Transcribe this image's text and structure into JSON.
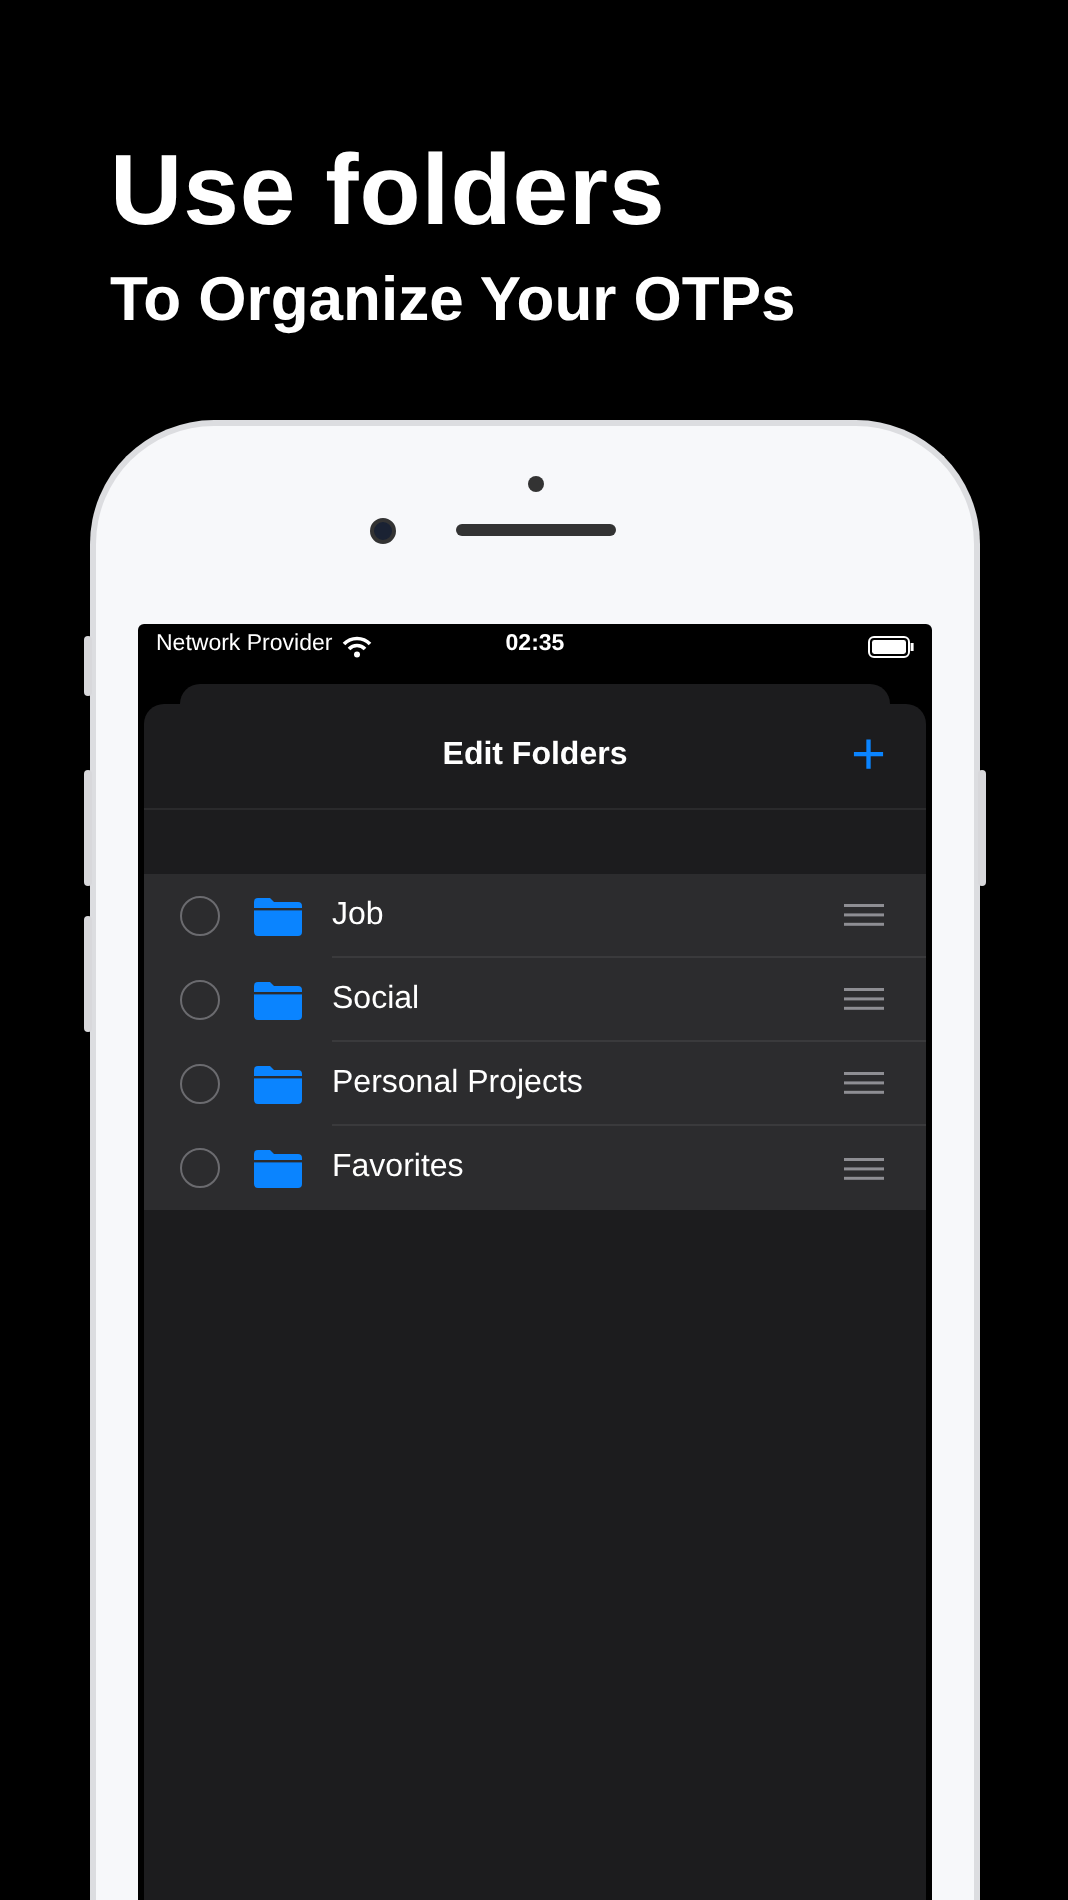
{
  "headline": {
    "title": "Use folders",
    "subtitle": "To Organize Your OTPs"
  },
  "status_bar": {
    "carrier": "Network Provider",
    "time": "02:35"
  },
  "sheet": {
    "title": "Edit Folders",
    "add_button": "+"
  },
  "folders": [
    {
      "name": "Job",
      "selected": false
    },
    {
      "name": "Social",
      "selected": false
    },
    {
      "name": "Personal Projects",
      "selected": false
    },
    {
      "name": "Favorites",
      "selected": false
    }
  ]
}
